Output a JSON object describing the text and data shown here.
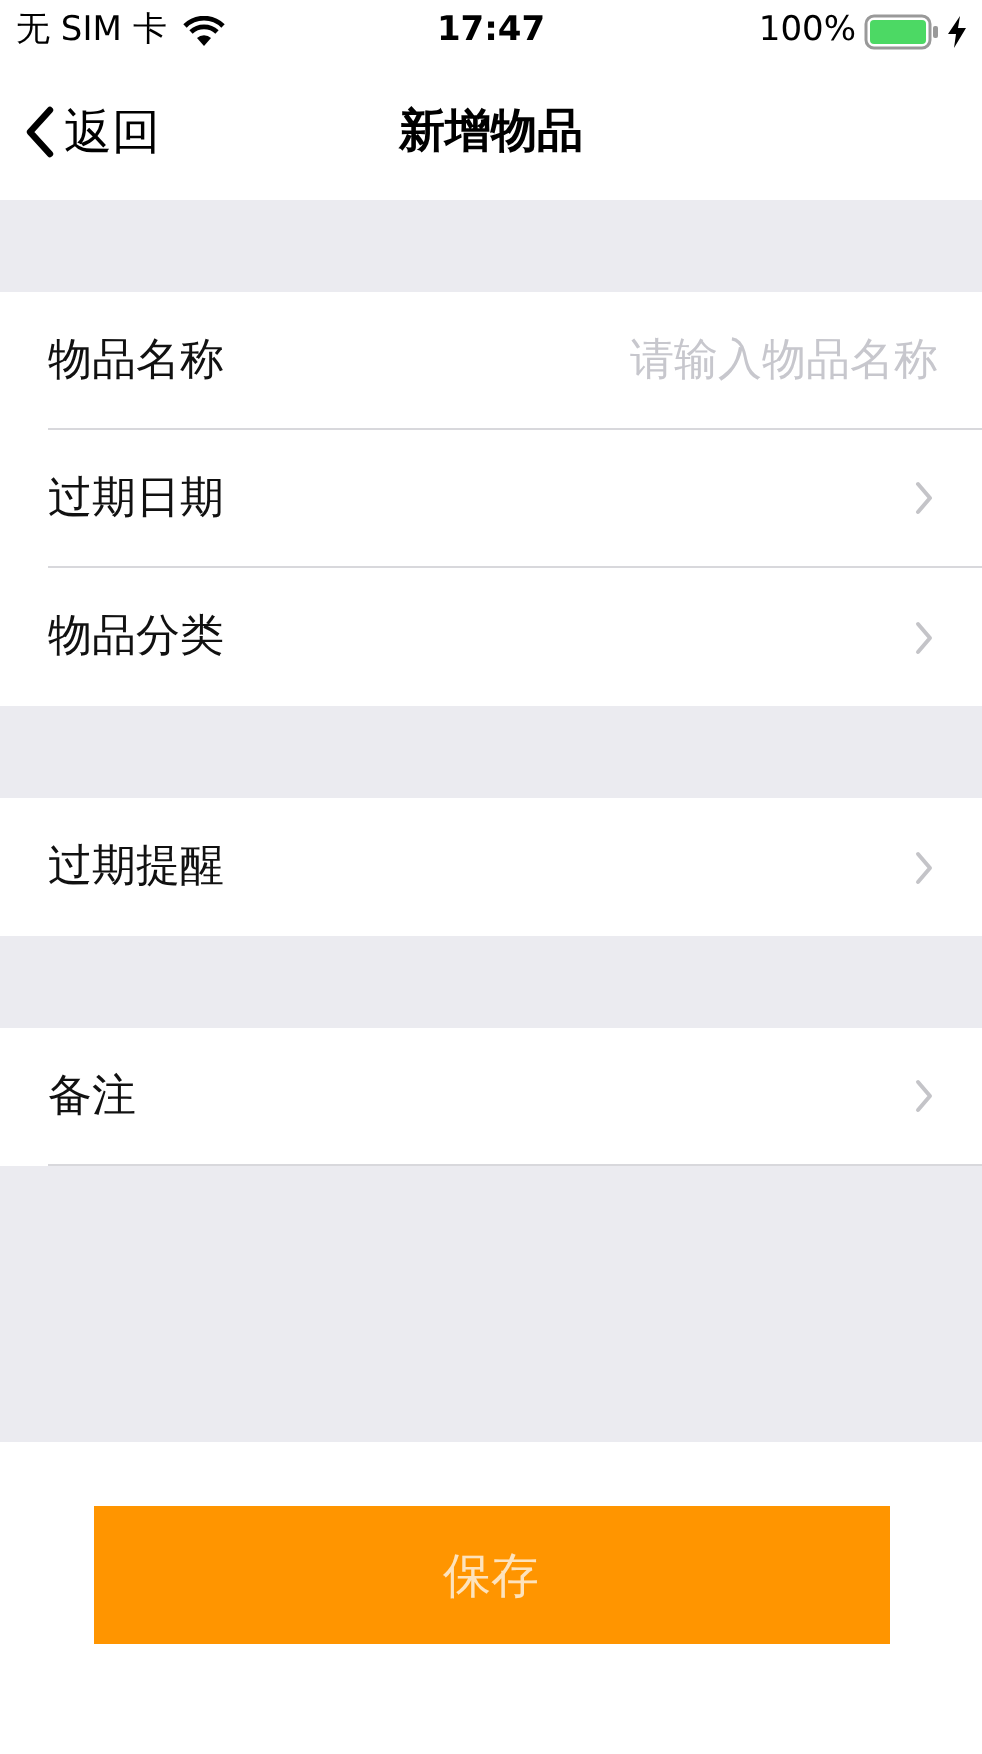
{
  "status_bar": {
    "carrier": "无 SIM 卡",
    "time": "17:47",
    "battery": "100%"
  },
  "nav_bar": {
    "back": "返回",
    "title": "新增物品"
  },
  "sections": [
    {
      "rows": [
        {
          "kind": "input",
          "label": "物品名称",
          "placeholder": "请输入物品名称"
        },
        {
          "kind": "disclosure",
          "label": "过期日期"
        },
        {
          "kind": "disclosure",
          "label": "物品分类"
        }
      ]
    },
    {
      "rows": [
        {
          "kind": "disclosure",
          "label": "过期提醒"
        }
      ]
    },
    {
      "rows": [
        {
          "kind": "disclosure",
          "label": "备注"
        }
      ]
    }
  ],
  "save_button": "保存"
}
